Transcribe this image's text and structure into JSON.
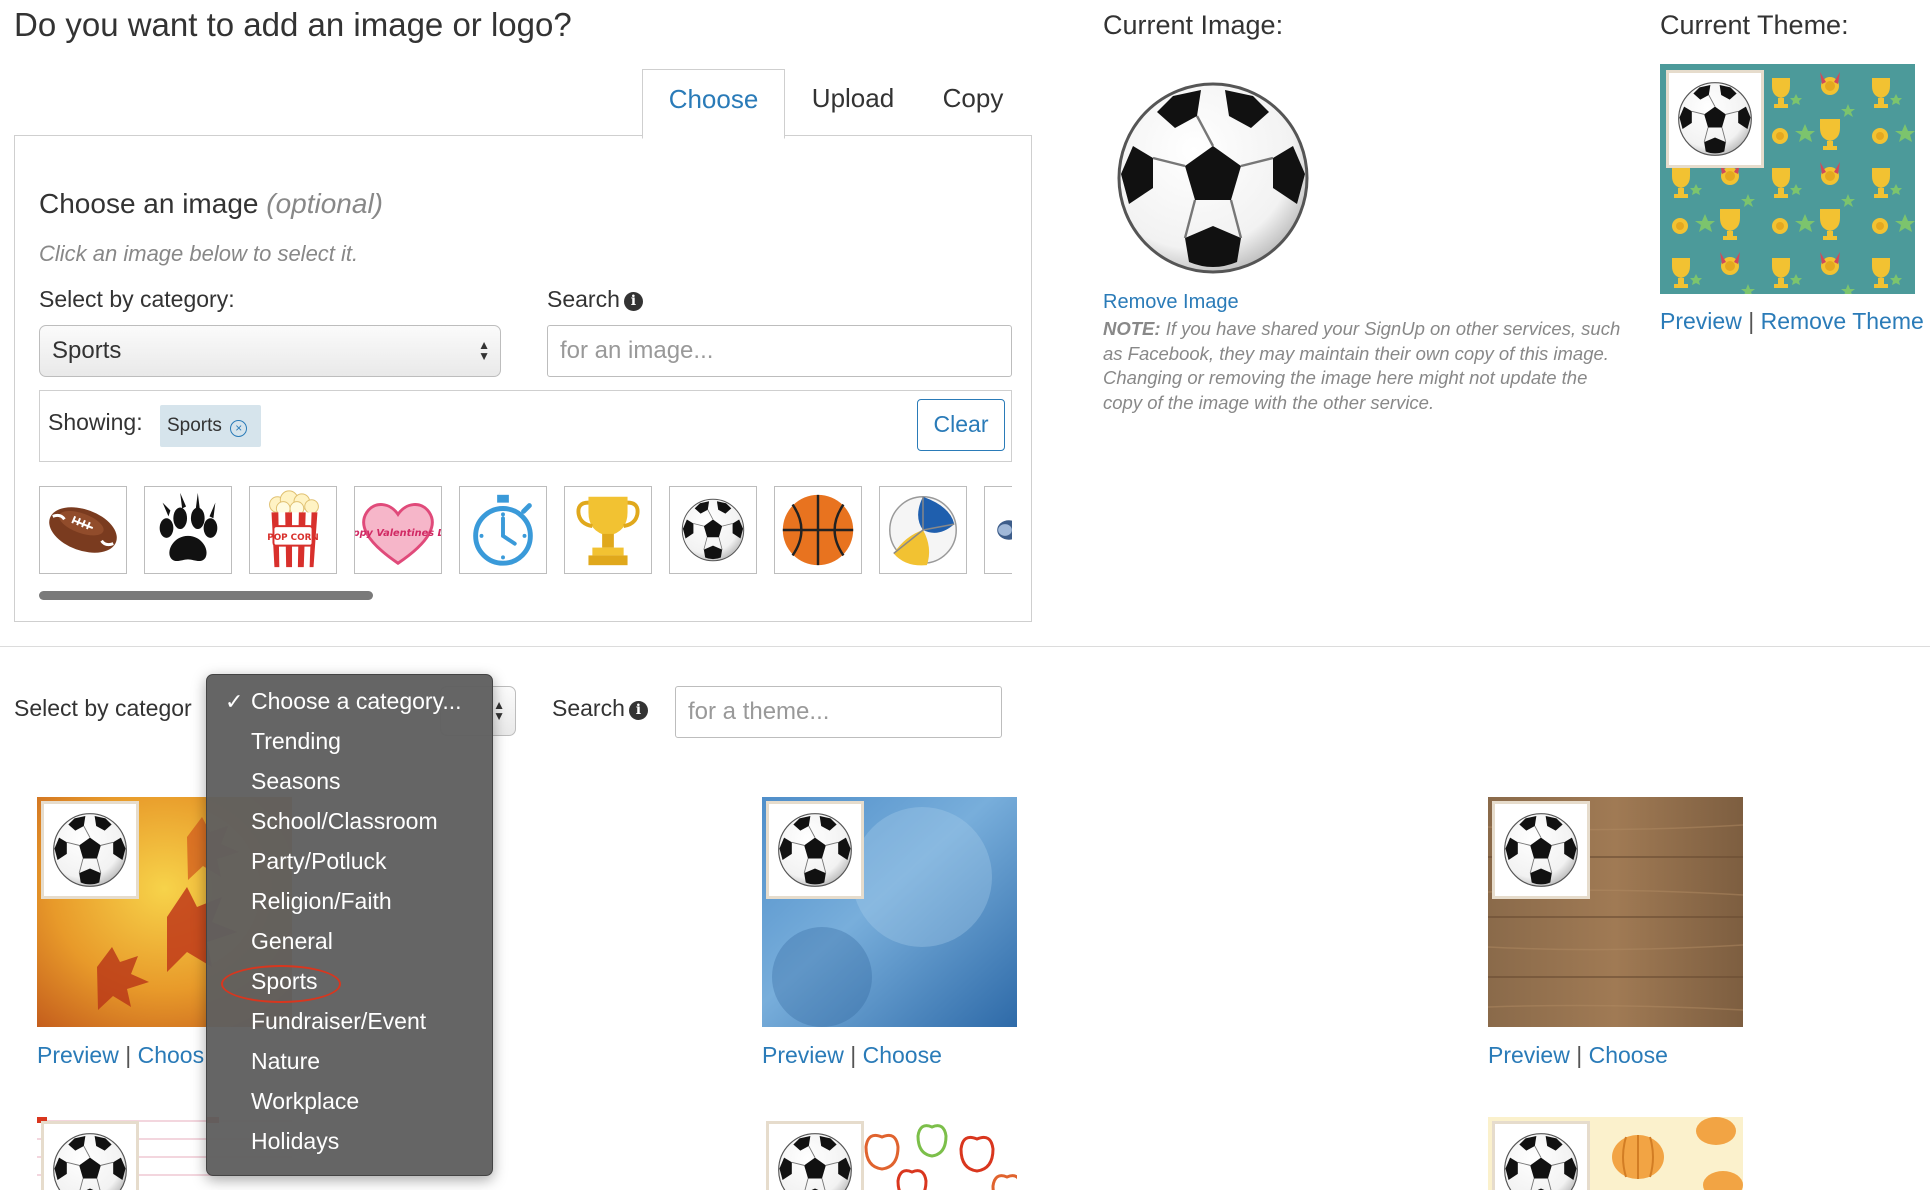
{
  "heading": "Do you want to add an image or logo?",
  "tabs": [
    {
      "label": "Choose",
      "active": true
    },
    {
      "label": "Upload",
      "active": false
    },
    {
      "label": "Copy",
      "active": false
    }
  ],
  "chooser": {
    "title": "Choose an image",
    "title_optional": "(optional)",
    "hint": "Click an image below to select it.",
    "category_label": "Select by category:",
    "category_value": "Sports",
    "search_label": "Search",
    "search_placeholder": "for an image...",
    "showing_label": "Showing:",
    "filter_chip": "Sports",
    "clear_label": "Clear",
    "thumbnails": [
      "football",
      "paw-print",
      "popcorn",
      "happy-valentines-day",
      "stopwatch",
      "trophy",
      "soccer-ball",
      "basketball",
      "volleyball",
      "partial-thumbnail"
    ],
    "popcorn_text": "POP CORN",
    "valentine_text": "Happy Valentines Day"
  },
  "current_image": {
    "label": "Current Image:",
    "remove_link": "Remove Image",
    "note_label": "NOTE:",
    "note_text": "If you have shared your SignUp on other services, such as Facebook, they may maintain their own copy of this image. Changing or removing the image here might not update the copy of the image with the other service."
  },
  "current_theme": {
    "label": "Current Theme:",
    "preview_link": "Preview",
    "separator": "|",
    "remove_link": "Remove Theme"
  },
  "theme_filter": {
    "category_label": "Select by categor",
    "search_label": "Search",
    "search_placeholder": "for a theme..."
  },
  "themes": [
    {
      "background": "autumn-leaves",
      "preview": "Preview",
      "separator": "|",
      "choose": "Choos"
    },
    {
      "background": "blue-texture",
      "preview": "Preview",
      "separator": "|",
      "choose": "Choose"
    },
    {
      "background": "wood-planks",
      "preview": "Preview",
      "separator": "|",
      "choose": "Choose"
    },
    {
      "background": "pink-stripes",
      "preview": "",
      "separator": "",
      "choose": ""
    },
    {
      "background": "apples-pattern",
      "preview": "",
      "separator": "",
      "choose": ""
    },
    {
      "background": "pumpkins",
      "preview": "",
      "separator": "",
      "choose": ""
    }
  ],
  "dropdown": {
    "checkmark": "✓",
    "items": [
      "Choose a category...",
      "Trending",
      "Seasons",
      "School/Classroom",
      "Party/Potluck",
      "Religion/Faith",
      "General",
      "Sports",
      "Fundraiser/Event",
      "Nature",
      "Workplace",
      "Holidays"
    ],
    "selected_index": 0,
    "highlighted_index": 7
  },
  "colors": {
    "link": "#2a7bb8",
    "chip_bg": "#d6e4ec",
    "dropdown_bg": "#5f5f5f",
    "highlight_circle": "#d9361e",
    "theme_pattern_bg": "#4c9a9a",
    "trophy_gold": "#f2c232"
  }
}
